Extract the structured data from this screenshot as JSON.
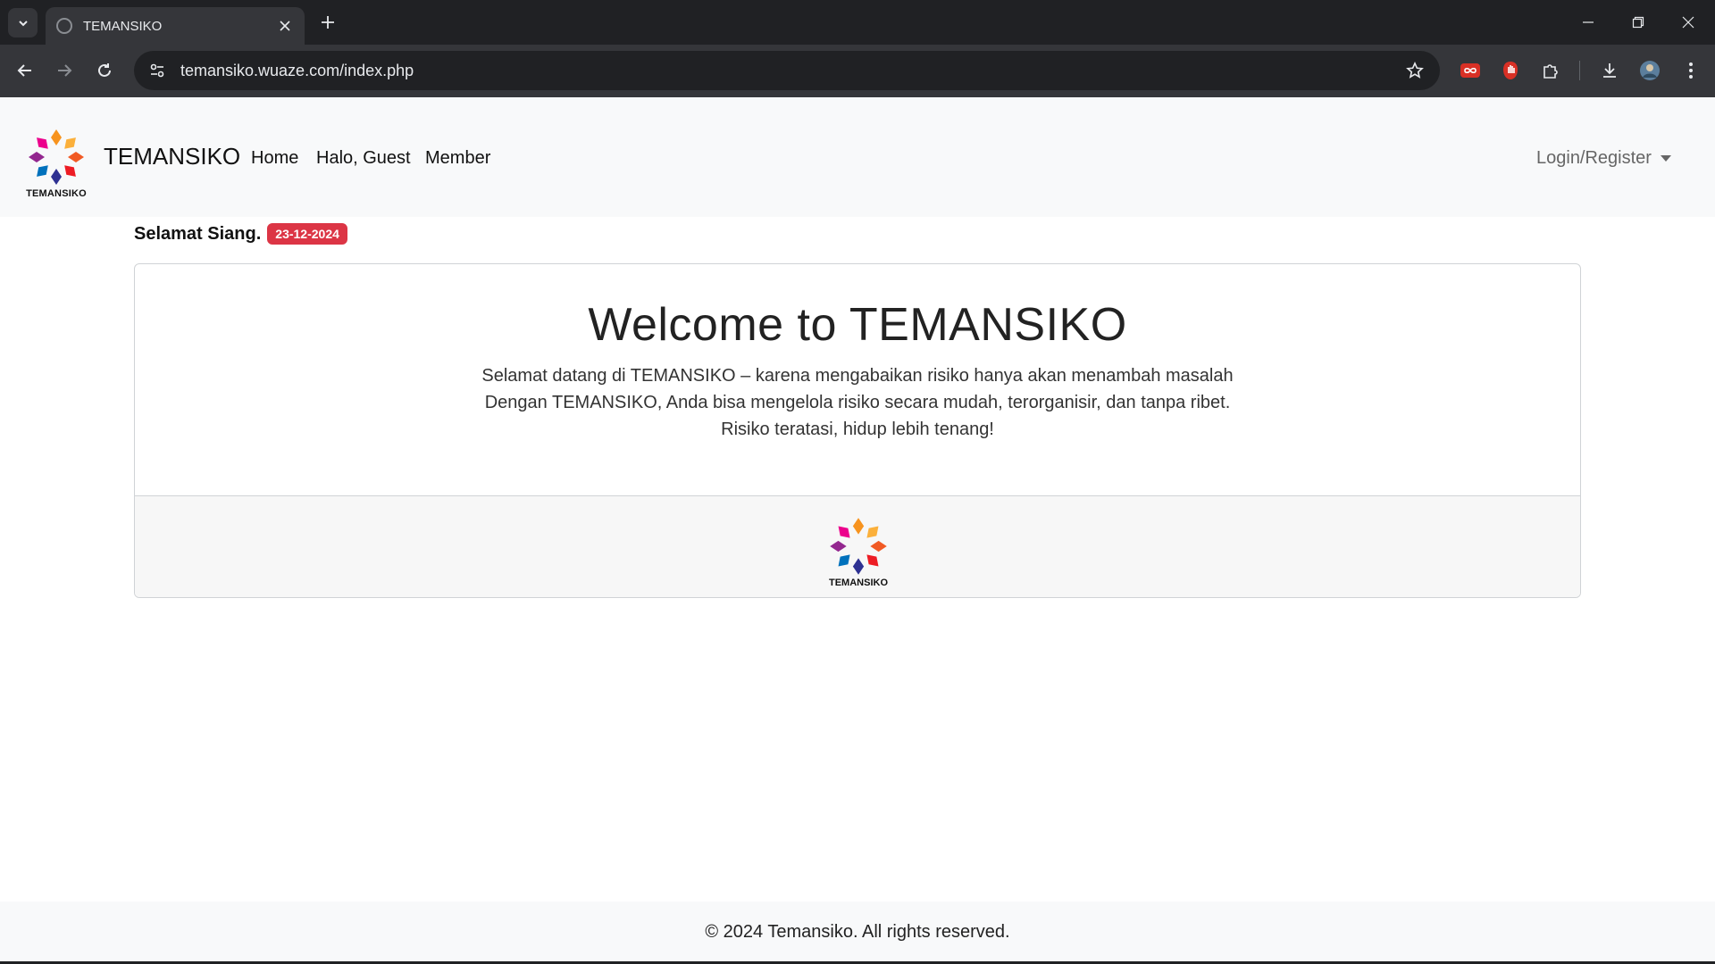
{
  "browser": {
    "tab_title": "TEMANSIKO",
    "url": "temansiko.wuaze.com/index.php"
  },
  "navbar": {
    "brand": "TEMANSIKO",
    "logo_text": "TEMANSIKO",
    "links": [
      "Home",
      "Halo, Guest",
      "Member"
    ],
    "login": "Login/Register"
  },
  "greeting": {
    "text": "Selamat Siang.",
    "date": "23-12-2024"
  },
  "card": {
    "title": "Welcome to TEMANSIKO",
    "lines": [
      "Selamat datang di TEMANSIKO – karena mengabaikan risiko hanya akan menambah masalah",
      "Dengan TEMANSIKO, Anda bisa mengelola risiko secara mudah, terorganisir, dan tanpa ribet.",
      "Risiko teratasi, hidup lebih tenang!"
    ],
    "footer_logo_text": "TEMANSIKO"
  },
  "footer": {
    "copyright": "© 2024 Temansiko. All rights reserved."
  },
  "colors": {
    "badge": "#dc3545",
    "navbar_bg": "#f8f9fa",
    "chrome_dark": "#202124",
    "chrome_toolbar": "#35363a"
  }
}
